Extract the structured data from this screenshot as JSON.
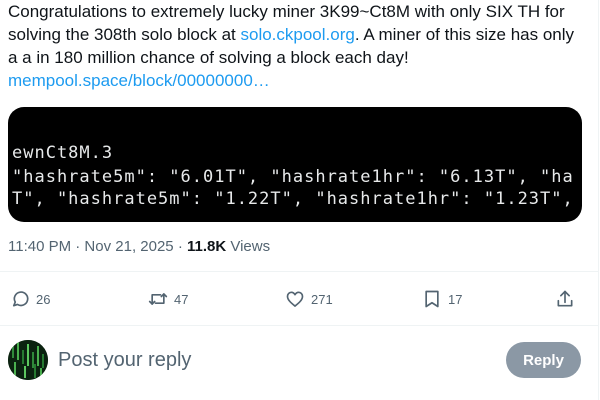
{
  "tweet": {
    "text_part1": "Congratulations to extremely lucky miner 3K99~Ct8M with only SIX TH for solving the 308th solo block at ",
    "link1": "solo.ckpool.org",
    "text_part2": ". A miner of this size has only a a in 180 million chance of solving a block each day!",
    "link2": "mempool.space/block/00000000…"
  },
  "media": {
    "lines": [
      "ewnCt8M.3",
      "\"hashrate5m\": \"6.01T\", \"hashrate1hr\": \"6.13T\", \"ha",
      "T\", \"hashrate5m\": \"1.22T\", \"hashrate1hr\": \"1.23T\","
    ]
  },
  "meta": {
    "timestamp": "11:40 PM · Nov 21, 2025",
    "separator": " · ",
    "views_count": "11.8K",
    "views_label": " Views"
  },
  "actions": {
    "reply_count": "26",
    "retweet_count": "47",
    "like_count": "271",
    "bookmark_count": "17",
    "icons": [
      "reply-icon",
      "retweet-icon",
      "like-icon",
      "bookmark-icon",
      "share-icon"
    ]
  },
  "composer": {
    "placeholder": "Post your reply",
    "reply_button": "Reply"
  },
  "colors": {
    "link": "#1d9bf0",
    "muted": "#536471",
    "text": "#0f1419",
    "media_bg": "#000000",
    "reply_button_bg": "#8b98a5"
  }
}
